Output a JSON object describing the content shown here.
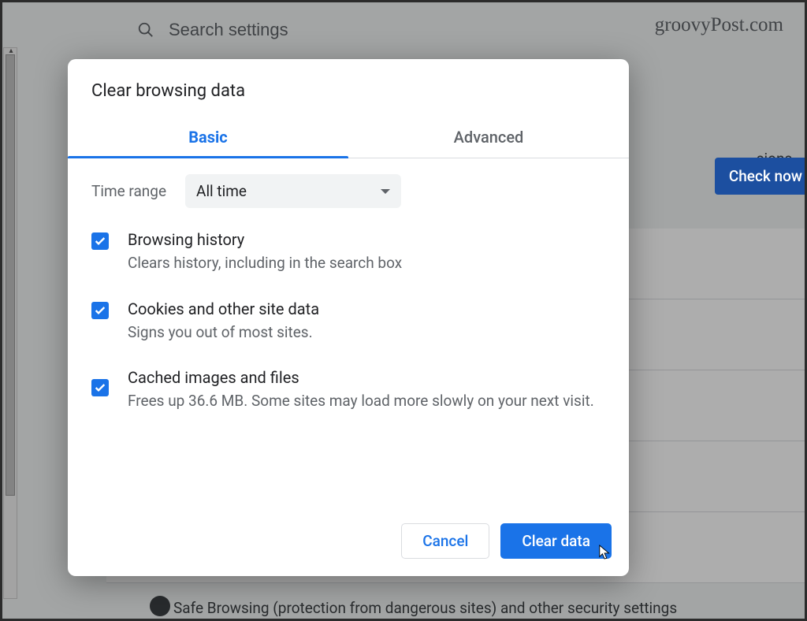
{
  "background": {
    "search_placeholder": "Search settings",
    "watermark": "groovyPost.com",
    "check_now_label": "Check now",
    "extensions_fragment": "sions,",
    "safe_browsing_text": "Safe Browsing (protection from dangerous sites) and other security settings"
  },
  "dialog": {
    "title": "Clear browsing data",
    "tabs": {
      "basic": "Basic",
      "advanced": "Advanced"
    },
    "time_range_label": "Time range",
    "time_range_value": "All time",
    "items": [
      {
        "title": "Browsing history",
        "desc": "Clears history, including in the search box"
      },
      {
        "title": "Cookies and other site data",
        "desc": "Signs you out of most sites."
      },
      {
        "title": "Cached images and files",
        "desc": "Frees up 36.6 MB. Some sites may load more slowly on your next visit."
      }
    ],
    "cancel_label": "Cancel",
    "clear_label": "Clear data"
  }
}
